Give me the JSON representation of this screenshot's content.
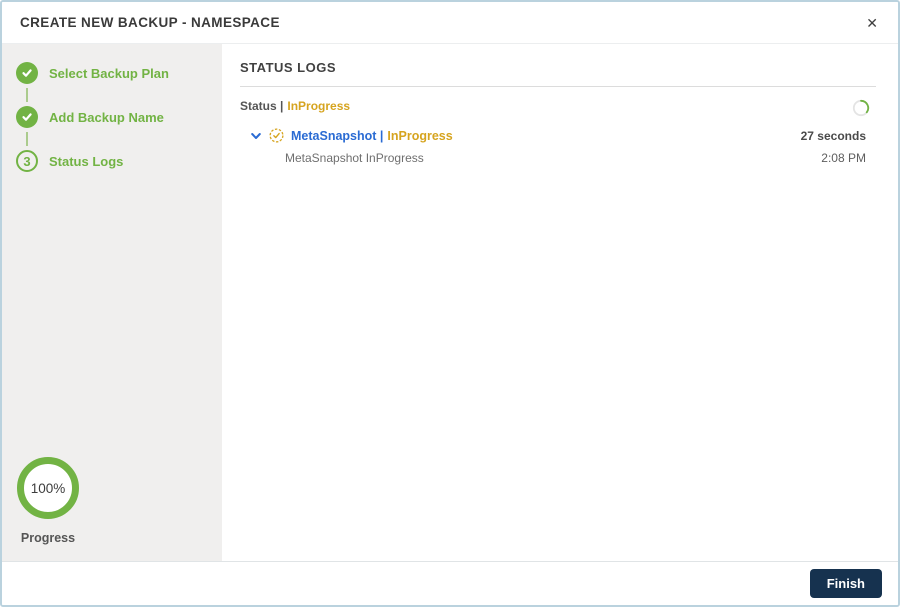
{
  "header": {
    "title": "CREATE NEW BACKUP - NAMESPACE",
    "close_glyph": "✕"
  },
  "stepper": {
    "steps": [
      {
        "label": "Select Backup Plan",
        "state": "complete"
      },
      {
        "label": "Add Backup Name",
        "state": "complete"
      },
      {
        "label": "Status Logs",
        "state": "current",
        "number": "3"
      }
    ],
    "progress": {
      "percent": "100%",
      "label": "Progress"
    }
  },
  "main": {
    "heading": "STATUS LOGS",
    "status_line": {
      "prefix": "Status |",
      "value": "InProgress"
    },
    "log_entries": [
      {
        "name": "MetaSnapshot |",
        "status": "InProgress",
        "duration": "27 seconds",
        "detail": "MetaSnapshot InProgress",
        "time": "2:08 PM"
      }
    ]
  },
  "footer": {
    "finish_label": "Finish"
  },
  "colors": {
    "green": "#72b344",
    "gold": "#d6a41f",
    "blue": "#2a6bd3",
    "navy": "#16324f",
    "border": "#bad2de"
  }
}
